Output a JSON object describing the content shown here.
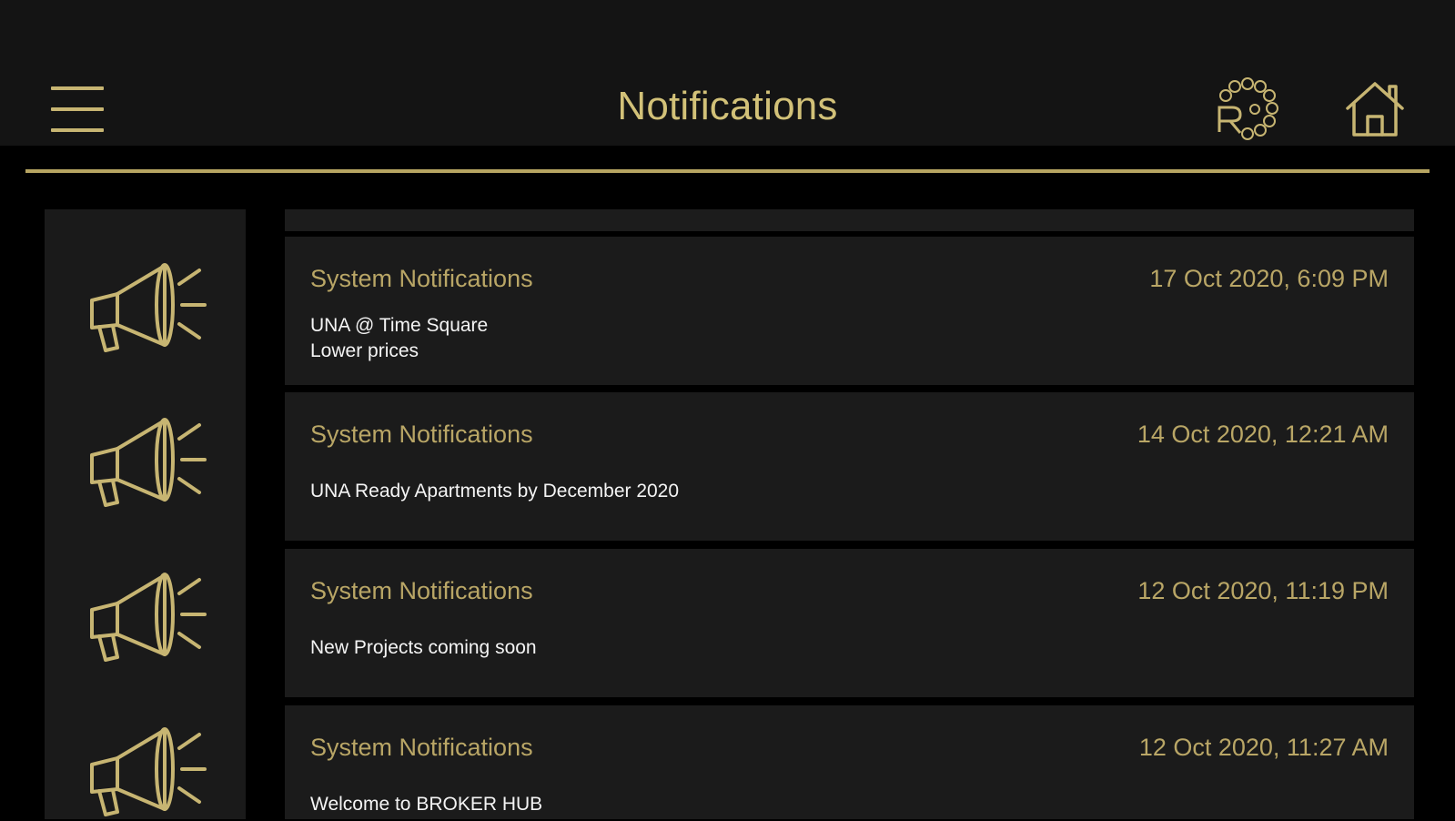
{
  "header": {
    "title": "Notifications",
    "menu_icon": "hamburger-menu-icon",
    "logo_icon": "brand-logo-icon",
    "home_icon": "home-icon"
  },
  "colors": {
    "background": "#000000",
    "header_background": "#141414",
    "card_background": "#1b1b1b",
    "accent_gold": "#c7b572",
    "body_text": "#f4f4f4"
  },
  "notifications": [
    {
      "icon": "megaphone-icon",
      "title": "System Notifications",
      "date": "17 Oct 2020, 6:09 PM",
      "lines": [
        "UNA @ Time Square",
        "Lower prices"
      ]
    },
    {
      "icon": "megaphone-icon",
      "title": "System Notifications",
      "date": "14 Oct 2020, 12:21 AM",
      "lines": [
        "UNA Ready Apartments by December 2020"
      ]
    },
    {
      "icon": "megaphone-icon",
      "title": "System Notifications",
      "date": "12 Oct 2020, 11:19 PM",
      "lines": [
        "New Projects coming soon"
      ]
    },
    {
      "icon": "megaphone-icon",
      "title": "System Notifications",
      "date": "12 Oct 2020, 11:27 AM",
      "lines": [
        "Welcome to BROKER HUB"
      ]
    }
  ]
}
